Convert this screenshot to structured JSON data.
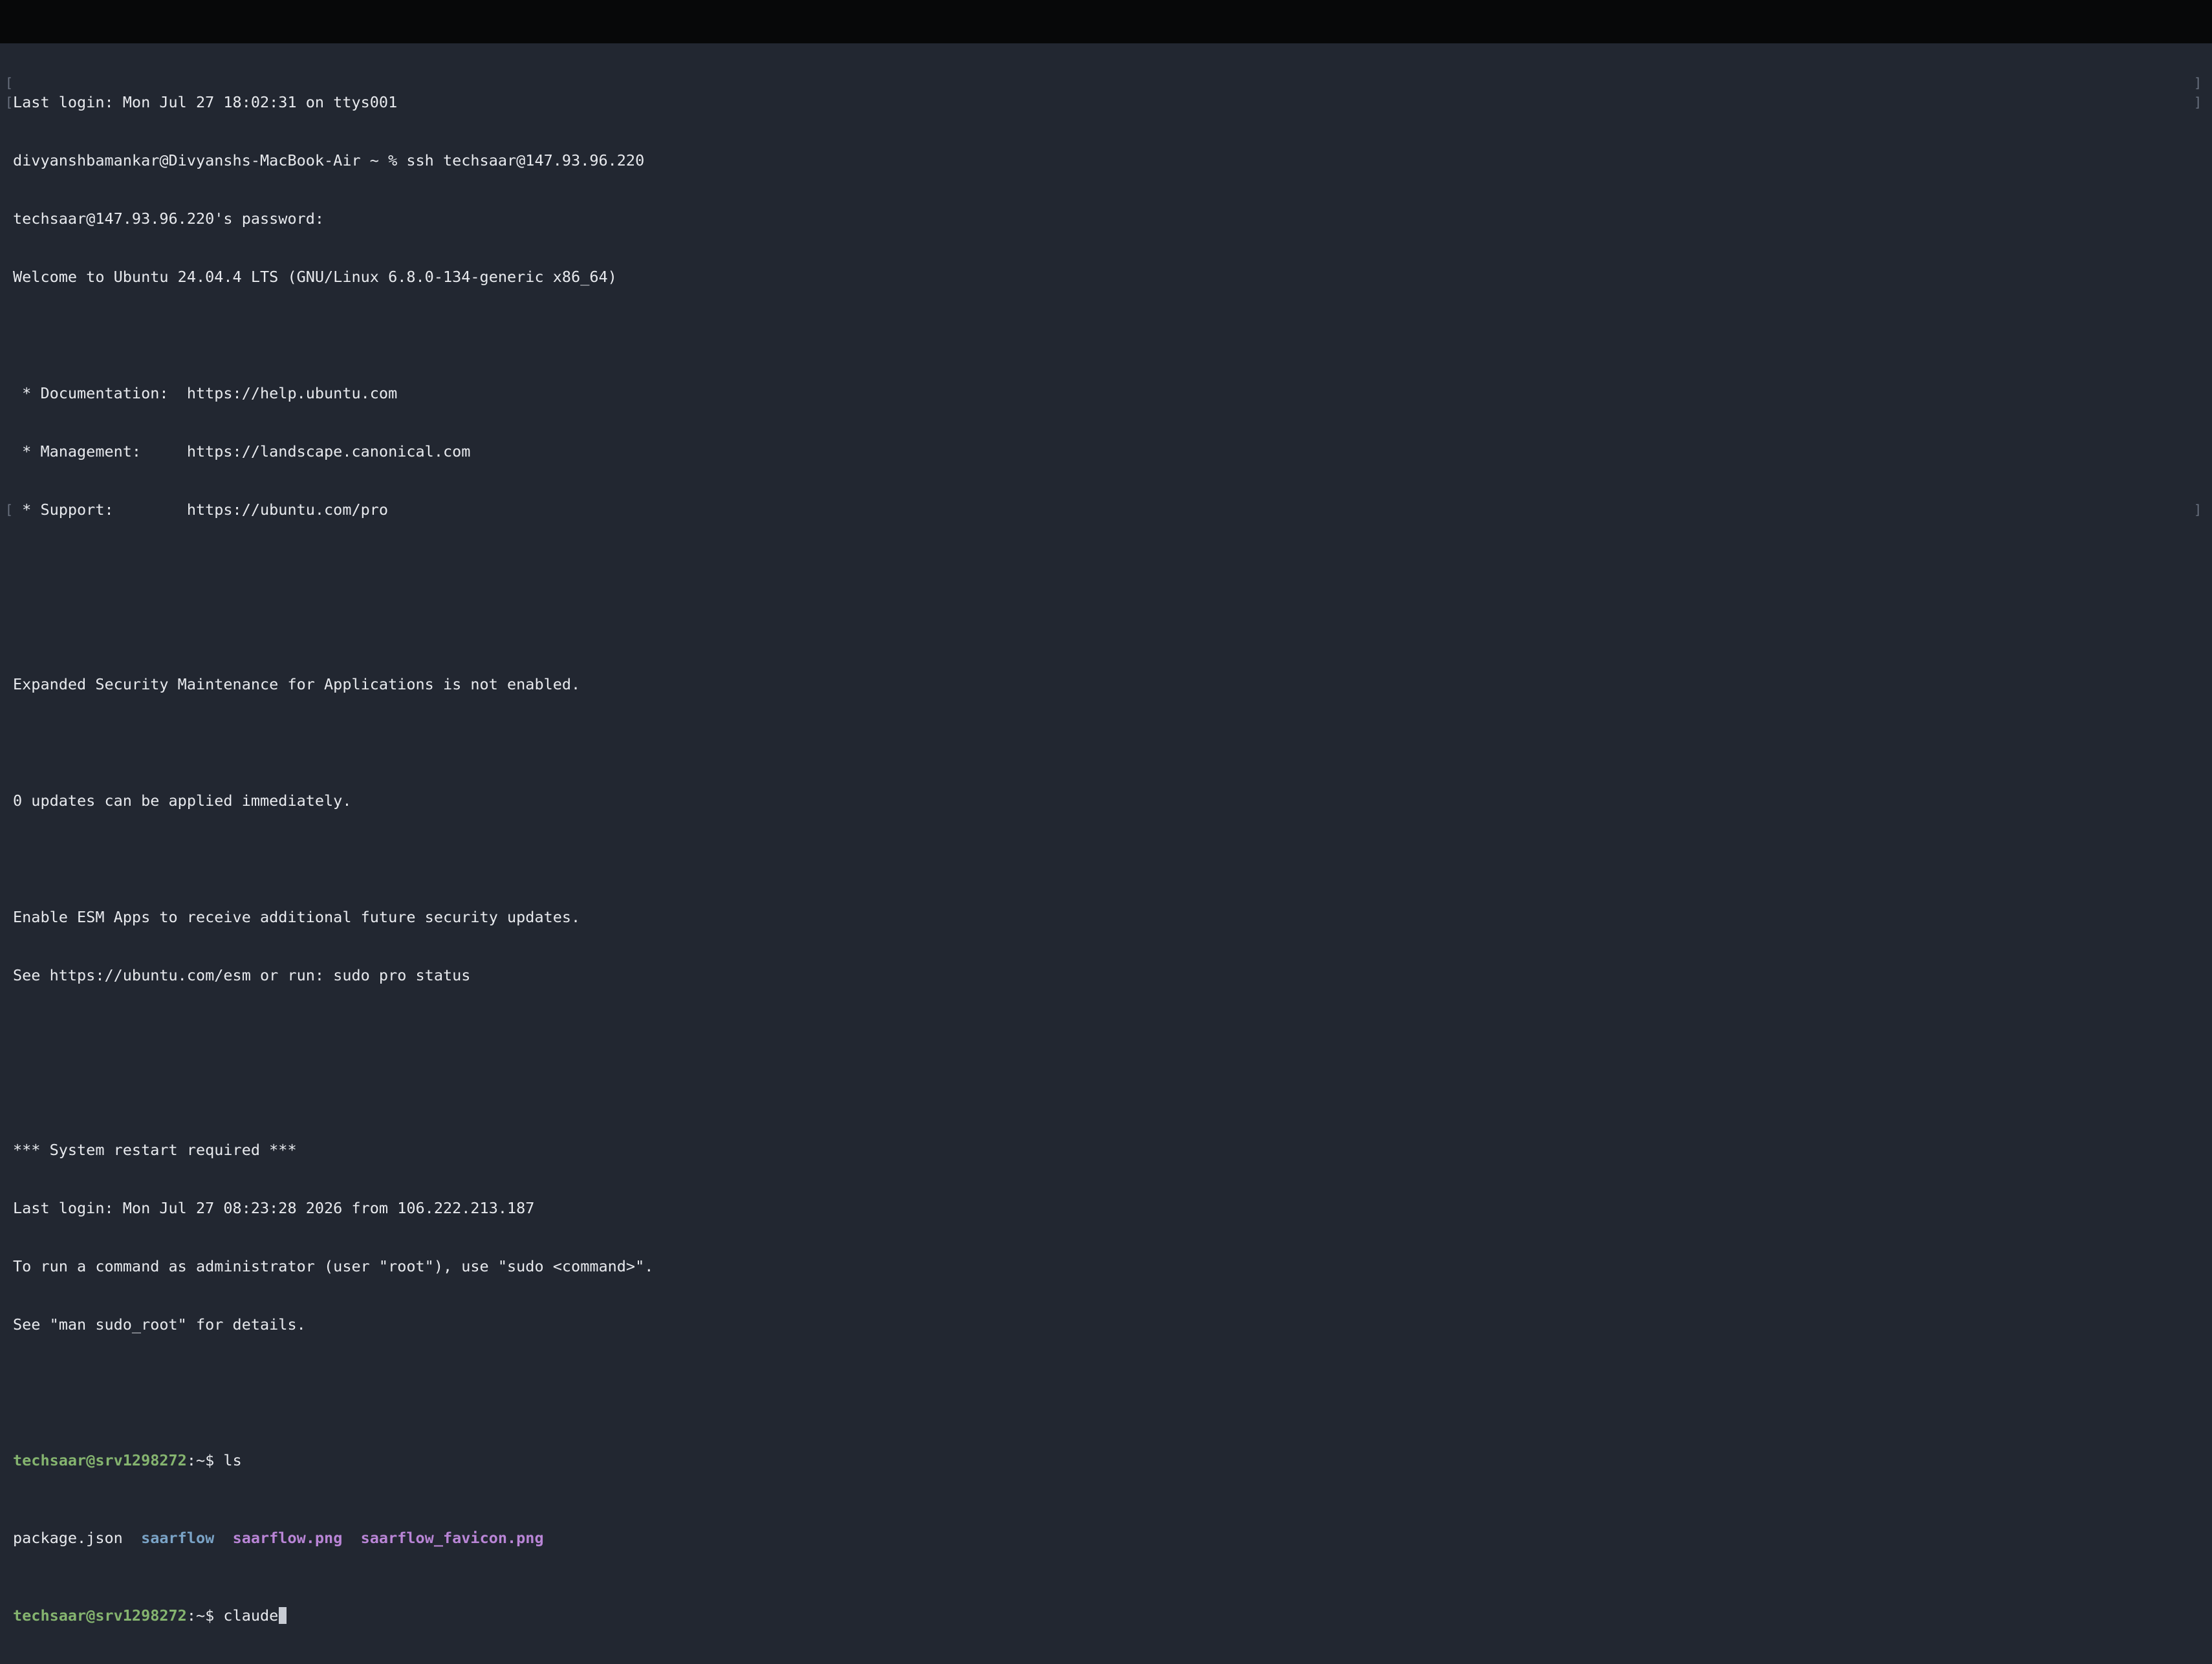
{
  "terminal": {
    "lines": [
      "Last login: Mon Jul 27 18:02:31 on ttys001",
      "divyanshbamankar@Divyanshs-MacBook-Air ~ % ssh techsaar@147.93.96.220",
      "techsaar@147.93.96.220's password:",
      "Welcome to Ubuntu 24.04.4 LTS (GNU/Linux 6.8.0-134-generic x86_64)",
      "",
      " * Documentation:  https://help.ubuntu.com",
      " * Management:     https://landscape.canonical.com",
      " * Support:        https://ubuntu.com/pro",
      "",
      "",
      "Expanded Security Maintenance for Applications is not enabled.",
      "",
      "0 updates can be applied immediately.",
      "",
      "Enable ESM Apps to receive additional future security updates.",
      "See https://ubuntu.com/esm or run: sudo pro status",
      "",
      "",
      "*** System restart required ***",
      "Last login: Mon Jul 27 08:23:28 2026 from 106.222.213.187",
      "To run a command as administrator (user \"root\"), use \"sudo <command>\".",
      "See \"man sudo_root\" for details.",
      ""
    ],
    "prompt_1": {
      "user_host": "techsaar@srv1298272",
      "suffix": ":~$ ",
      "command": "ls"
    },
    "ls_output": {
      "file_1": "package.json",
      "dir_1": "saarflow",
      "image_1": "saarflow.png",
      "image_2": "saarflow_favicon.png"
    },
    "prompt_2": {
      "user_host": "techsaar@srv1298272",
      "suffix": ":~$ ",
      "command": "claude"
    },
    "marks": {
      "open": "[",
      "close": "]"
    },
    "colors": {
      "background": "#222731",
      "titlebar": "#070809",
      "text": "#e8eaee",
      "prompt_user": "#85b46f",
      "directory": "#7aa3c6",
      "image_file": "#b985d6"
    }
  }
}
